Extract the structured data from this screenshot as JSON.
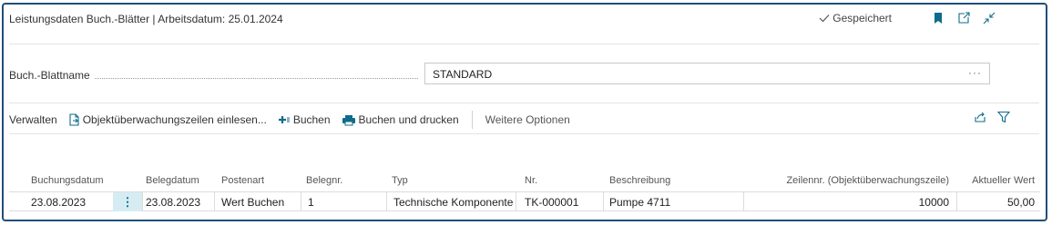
{
  "header": {
    "title": "Leistungsdaten Buch.-Blätter | Arbeitsdatum: 25.01.2024",
    "saved_label": "Gespeichert"
  },
  "journal": {
    "label": "Buch.-Blattname",
    "value": "STANDARD",
    "more": "···"
  },
  "actions": {
    "manage": "Verwalten",
    "load_lines": "Objektüberwachungszeilen einlesen...",
    "post": "Buchen",
    "post_print": "Buchen und drucken",
    "more_options": "Weitere Optionen"
  },
  "table": {
    "columns": {
      "posting_date": "Buchungsdatum",
      "doc_date": "Belegdatum",
      "entry_type": "Postenart",
      "doc_no": "Belegnr.",
      "type": "Typ",
      "no": "Nr.",
      "description": "Beschreibung",
      "line_no": "Zeilennr. (Objektüberwachungszeile)",
      "current_value": "Aktueller Wert"
    },
    "rows": [
      {
        "posting_date": "23.08.2023",
        "doc_date": "23.08.2023",
        "entry_type": "Wert Buchen",
        "doc_no": "1",
        "type": "Technische Komponente",
        "no": "TK-000001",
        "description": "Pumpe 4711",
        "line_no": "10000",
        "current_value": "50,00"
      }
    ]
  },
  "colors": {
    "accent": "#0f6b8a",
    "frame": "#1f4e79",
    "row_menu_bg": "#d6ecf3"
  }
}
